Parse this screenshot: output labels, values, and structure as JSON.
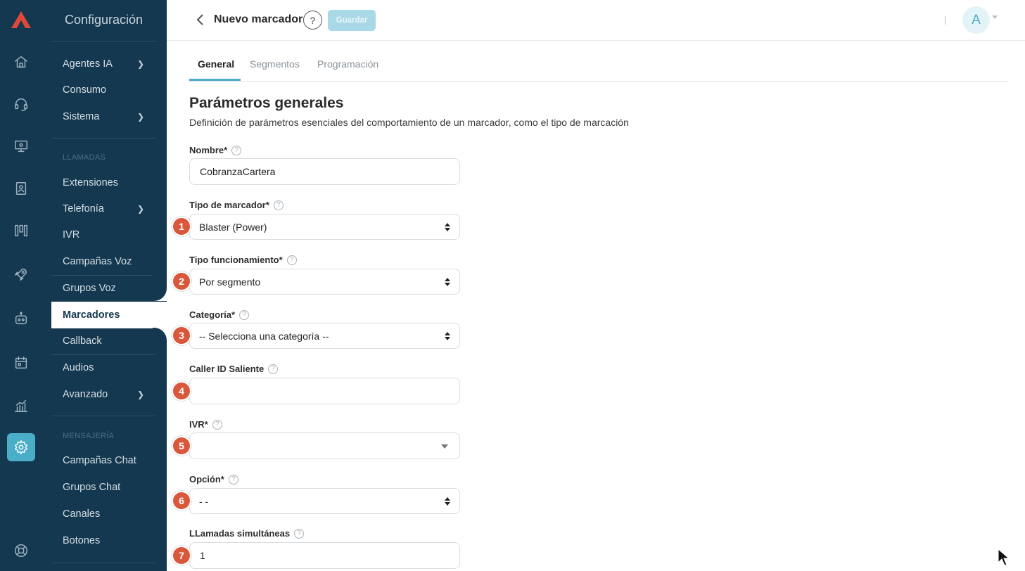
{
  "nav": {
    "title": "Configuración",
    "items_top": [
      {
        "label": "Agentes IA",
        "chevron": true
      },
      {
        "label": "Consumo",
        "chevron": false
      },
      {
        "label": "Sistema",
        "chevron": true
      }
    ],
    "section_calls": "LLAMADAS",
    "items_calls": [
      {
        "label": "Extensiones",
        "chevron": false
      },
      {
        "label": "Telefonía",
        "chevron": true
      },
      {
        "label": "IVR",
        "chevron": false
      },
      {
        "label": "Campañas Voz",
        "chevron": false
      },
      {
        "label": "Grupos Voz",
        "chevron": false
      },
      {
        "label": "Marcadores",
        "chevron": false,
        "active": true
      },
      {
        "label": "Callback",
        "chevron": false
      },
      {
        "label": "Audios",
        "chevron": false
      },
      {
        "label": "Avanzado",
        "chevron": true
      }
    ],
    "section_msg": "MENSAJERÍA",
    "items_msg": [
      {
        "label": "Campañas Chat"
      },
      {
        "label": "Grupos Chat"
      },
      {
        "label": "Canales"
      },
      {
        "label": "Botones"
      }
    ]
  },
  "header": {
    "title": "Nuevo marcador",
    "help": "?",
    "save_label": "Guardar",
    "avatar_initial": "A"
  },
  "tabs": [
    "General",
    "Segmentos",
    "Programación"
  ],
  "section": {
    "title": "Parámetros generales",
    "description": "Definición de parámetros esenciales del comportamiento de un marcador, como el tipo de marcación"
  },
  "form": {
    "nombre": {
      "label": "Nombre*",
      "value": "CobranzaCartera"
    },
    "tipo_marcador": {
      "label": "Tipo de marcador*",
      "value": "Blaster (Power)",
      "badge": "1"
    },
    "tipo_funcionamiento": {
      "label": "Tipo funcionamiento*",
      "value": "Por segmento",
      "badge": "2"
    },
    "categoria": {
      "label": "Categoría*",
      "value": "-- Selecciona una categoría --",
      "badge": "3"
    },
    "caller_id": {
      "label": "Caller ID Saliente",
      "value": "",
      "badge": "4"
    },
    "ivr": {
      "label": "IVR*",
      "value": "",
      "badge": "5"
    },
    "opcion": {
      "label": "Opción*",
      "value": "- -",
      "badge": "6"
    },
    "llamadas": {
      "label": "LLamadas simultáneas",
      "value": "1",
      "badge": "7"
    }
  },
  "help_glyph": "?",
  "colors": {
    "sidebar": "#14384f",
    "accent": "#4aaec8",
    "badge": "#d9573b"
  }
}
